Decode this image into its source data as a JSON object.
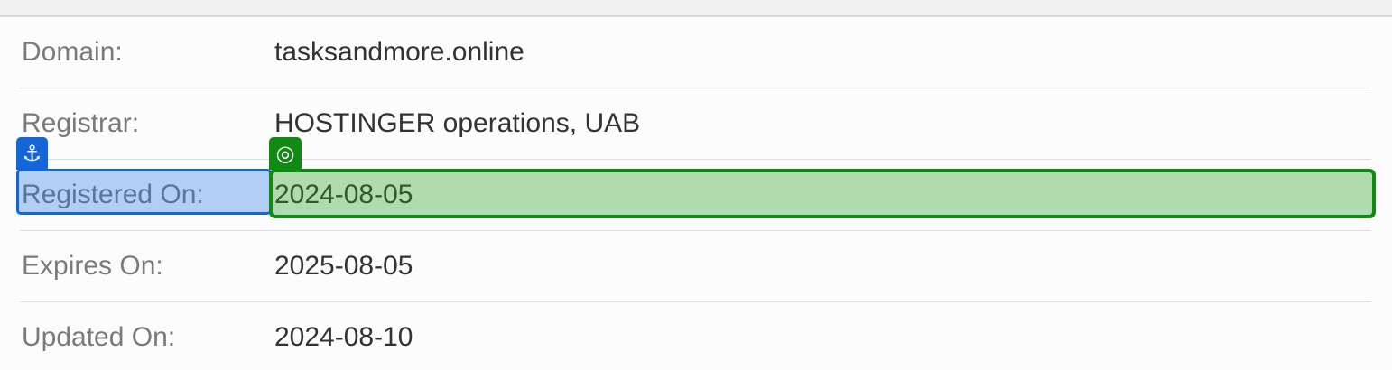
{
  "rows": [
    {
      "label": "Domain:",
      "value": "tasksandmore.online"
    },
    {
      "label": "Registrar:",
      "value": "HOSTINGER operations, UAB"
    },
    {
      "label": "Registered On:",
      "value": "2024-08-05"
    },
    {
      "label": "Expires On:",
      "value": "2025-08-05"
    },
    {
      "label": "Updated On:",
      "value": "2024-08-10"
    }
  ],
  "annotations": {
    "anchor": {
      "icon": "anchor-icon",
      "glyph": "⚓",
      "color": "#1466d6"
    },
    "target": {
      "icon": "target-icon",
      "glyph": "◎",
      "color": "#118a11"
    }
  }
}
